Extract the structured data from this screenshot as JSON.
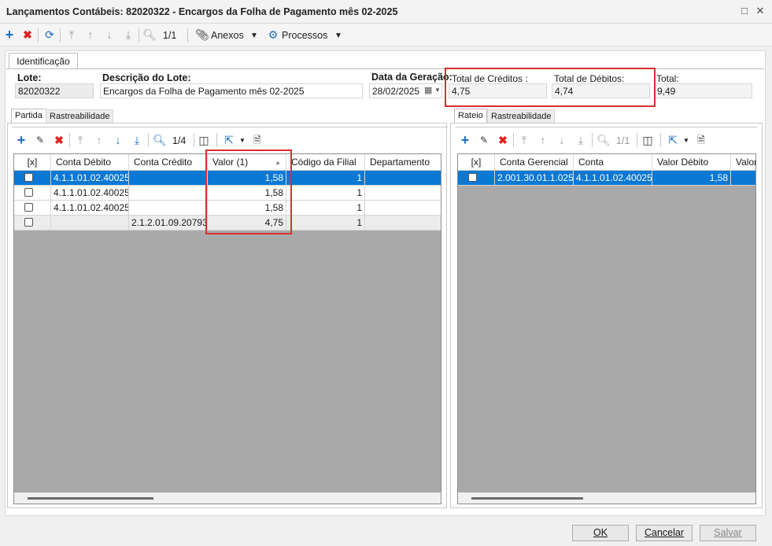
{
  "window": {
    "title": "Lançamentos Contábeis: 82020322 - Encargos da Folha de Pagamento mês 02-2025",
    "restore_glyph": "□",
    "close_glyph": "✕"
  },
  "toolbar": {
    "record_counter": "1/1",
    "anexos_label": "Anexos",
    "processos_label": "Processos"
  },
  "tabs": {
    "identificacao": "Identificação"
  },
  "header_fields": {
    "lote_label": "Lote:",
    "lote_value": "82020322",
    "descricao_label": "Descrição do Lote:",
    "descricao_value": "Encargos da Folha de Pagamento mês 02-2025",
    "data_label": "Data da Geração:",
    "data_value": "28/02/2025",
    "total_creditos_label": "Total de Créditos :",
    "total_creditos_value": "4,75",
    "total_debitos_label": "Total de Débitos:",
    "total_debitos_value": "4,74",
    "total_label": "Total:",
    "total_value": "9,49"
  },
  "left_panel": {
    "tabs": [
      "Partida",
      "Rastreabilidade"
    ],
    "record_counter": "1/4",
    "columns": [
      "[x]",
      "Conta Débito",
      "Conta Crédito",
      "Valor (1)",
      "Código da Filial",
      "Departamento"
    ],
    "rows": [
      {
        "conta_debito": "4.1.1.01.02.40025",
        "conta_credito": "",
        "valor": "1,58",
        "filial": "1",
        "departamento": ""
      },
      {
        "conta_debito": "4.1.1.01.02.40025",
        "conta_credito": "",
        "valor": "1,58",
        "filial": "1",
        "departamento": ""
      },
      {
        "conta_debito": "4.1.1.01.02.40025",
        "conta_credito": "",
        "valor": "1,58",
        "filial": "1",
        "departamento": ""
      },
      {
        "conta_debito": "",
        "conta_credito": "2.1.2.01.09.20793",
        "valor": "4,75",
        "filial": "1",
        "departamento": ""
      }
    ]
  },
  "right_panel": {
    "tabs": [
      "Rateio",
      "Rastreabilidade"
    ],
    "record_counter": "1/1",
    "columns": [
      "[x]",
      "Conta Gerencial",
      "Conta",
      "Valor Débito",
      "Valor"
    ],
    "rows": [
      {
        "conta_gerencial": "2.001.30.01.1.025",
        "conta": "4.1.1.01.02.40025",
        "valor_debito": "1,58",
        "valor": ""
      }
    ]
  },
  "footer": {
    "ok_label": "OK",
    "cancelar_label": "Cancelar",
    "salvar_label": "Salvar"
  },
  "colors": {
    "selection": "#0b78d4",
    "highlight_box": "#d83030",
    "grid_background": "#a9a9a9"
  }
}
